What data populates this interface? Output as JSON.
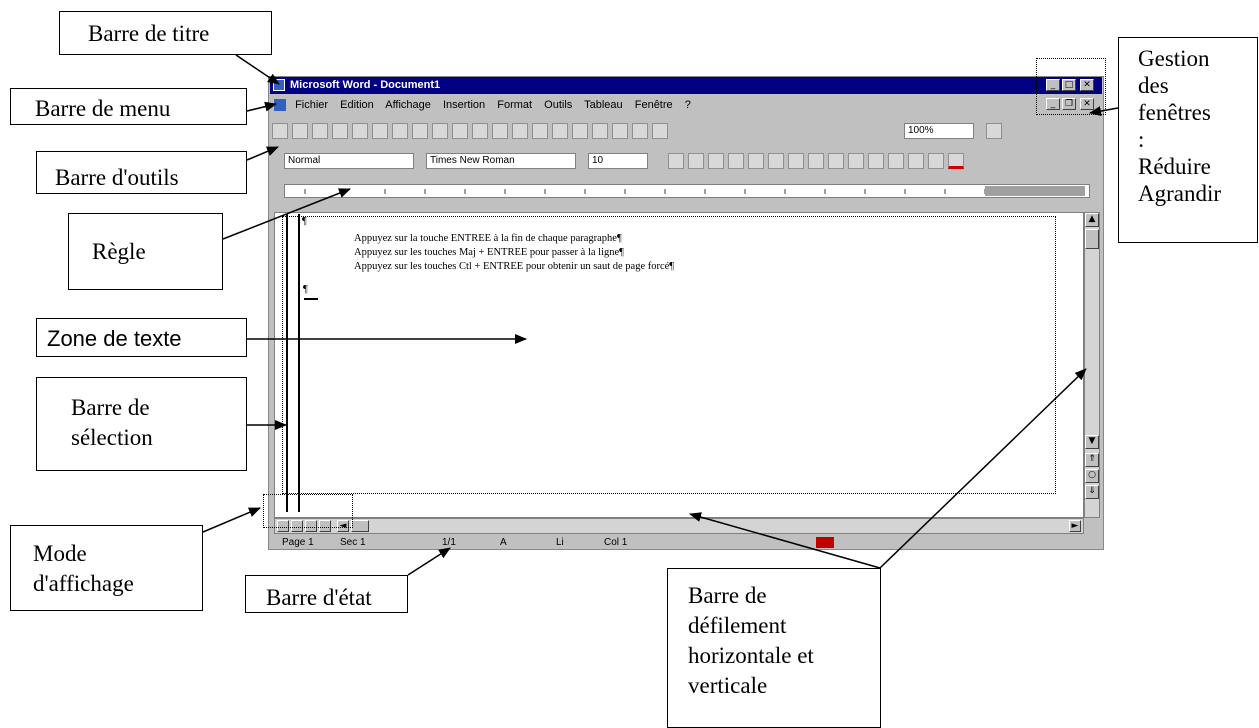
{
  "callouts": {
    "barre_titre": "Barre de titre",
    "barre_menu": "Barre de menu",
    "barre_outils": "Barre d'outils",
    "regle": "Règle",
    "zone_texte": "Zone de texte",
    "barre_selection_1": "Barre de",
    "barre_selection_2": "sélection",
    "mode_affichage_1": "Mode",
    "mode_affichage_2": "d'affichage",
    "barre_etat": "Barre d'état",
    "gestion_1": "Gestion",
    "gestion_2": "des",
    "gestion_3": "fenêtres",
    "gestion_4": ":",
    "gestion_5": "Réduire",
    "gestion_6": "Agrandir",
    "defilement_1": "Barre de",
    "defilement_2": "défilement",
    "defilement_3": "horizontale et",
    "defilement_4": "verticale"
  },
  "window": {
    "title": "Microsoft Word - Document1",
    "menu": [
      "Fichier",
      "Edition",
      "Affichage",
      "Insertion",
      "Format",
      "Outils",
      "Tableau",
      "Fenêtre",
      "?"
    ],
    "style_value": "Normal",
    "font_value": "Times New Roman",
    "size_value": "10",
    "zoom_value": "100%",
    "doc_lines": [
      "Appuyez sur la touche ENTREE à la fin de chaque paragraphe¶",
      "Appuyez sur les touches Maj + ENTREE pour passer à la ligne¶",
      "Appuyez sur les touches Ctl + ENTREE pour obtenir un saut de page forcé¶"
    ],
    "pilcrow": "¶",
    "status": {
      "page": "Page 1",
      "sec": "Sec 1",
      "pos": "1/1",
      "at": "A",
      "ln": "Li",
      "col": "Col 1"
    }
  }
}
